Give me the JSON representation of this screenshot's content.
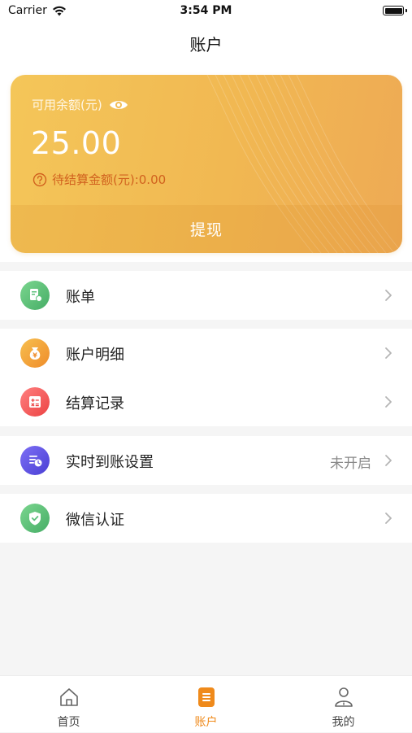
{
  "status_bar": {
    "carrier": "Carrier",
    "time": "3:54 PM",
    "icons": [
      "wifi-icon",
      "battery-icon"
    ]
  },
  "nav": {
    "title": "账户"
  },
  "balance_card": {
    "available_label": "可用余额(元)",
    "amount": "25.00",
    "pending_label": "待结算金额(元):0.00",
    "withdraw_label": "提现",
    "colors": {
      "gradient_start": "#f4c659",
      "gradient_end": "#eeaa55",
      "pending_text": "#d1611e"
    }
  },
  "menu": {
    "bill": {
      "label": "账单",
      "icon": "bill-icon",
      "color": "#5cc07a"
    },
    "account_detail": {
      "label": "账户明细",
      "icon": "money-bag-icon",
      "color": "#f2a23a"
    },
    "settlement_record": {
      "label": "结算记录",
      "icon": "calculator-icon",
      "color": "#f25a5a"
    },
    "realtime_settings": {
      "label": "实时到账设置",
      "value": "未开启",
      "icon": "clock-list-icon",
      "color": "#5a4fe0"
    },
    "wechat_verify": {
      "label": "微信认证",
      "icon": "shield-check-icon",
      "color": "#5cc07a"
    }
  },
  "tabbar": {
    "active_color": "#ef8a1b",
    "tabs": [
      {
        "label": "首页",
        "icon": "home-icon",
        "active": false
      },
      {
        "label": "账户",
        "icon": "account-doc-icon",
        "active": true
      },
      {
        "label": "我的",
        "icon": "profile-icon",
        "active": false
      }
    ]
  }
}
